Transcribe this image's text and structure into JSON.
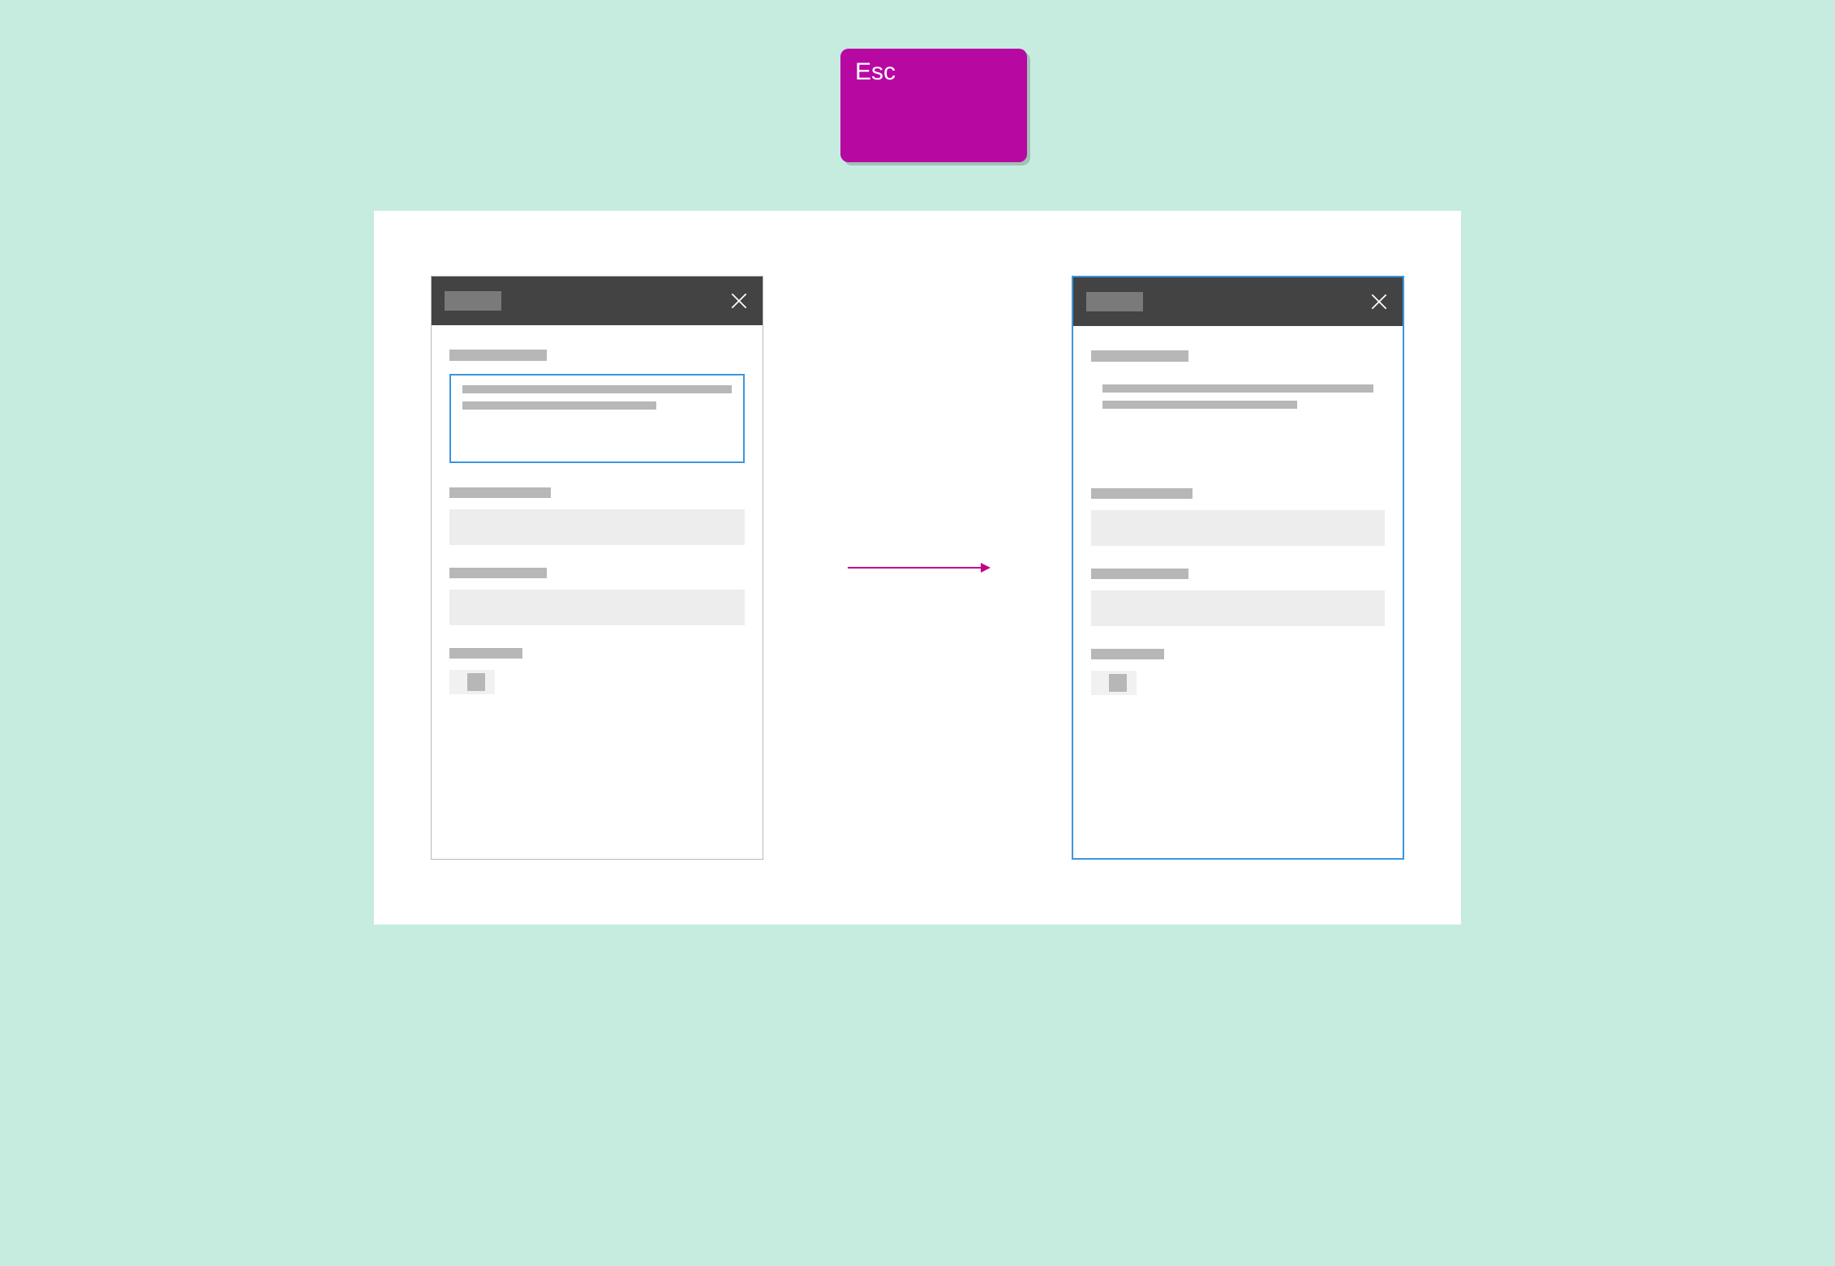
{
  "key": {
    "label": "Esc"
  },
  "colors": {
    "background": "#c6ece0",
    "key": "#b708a2",
    "arrow": "#c2008b",
    "focus": "#3a96de",
    "header": "#434343"
  },
  "before": {
    "focused_element": "textarea",
    "dialog_focused": false
  },
  "after": {
    "focused_element": null,
    "dialog_focused": true
  }
}
